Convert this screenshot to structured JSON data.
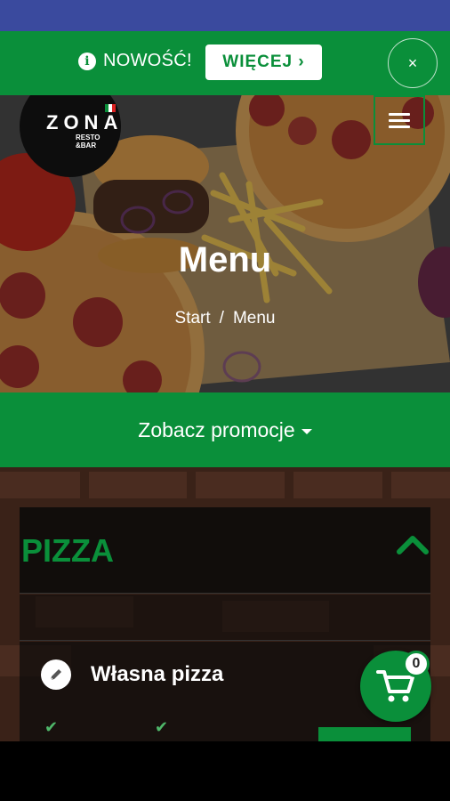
{
  "notice": {
    "text": "NOWOŚĆ!",
    "button_label": "WIĘCEJ ›",
    "close_label": "×"
  },
  "header": {
    "logo_text": "ZONA",
    "logo_sub_line1": "RESTO",
    "logo_sub_line2": "&BAR"
  },
  "hero": {
    "title": "Menu",
    "breadcrumb": {
      "home": "Start",
      "separator": "/",
      "current": "Menu"
    }
  },
  "promotions": {
    "label": "Zobacz promocje"
  },
  "category": {
    "title": "PIZZA"
  },
  "product": {
    "name": "Własna pizza"
  },
  "cart": {
    "count": "0"
  },
  "colors": {
    "brand_green": "#0a8f3a",
    "status_bar": "#3a4a9e"
  },
  "icons": {
    "info": "info-icon",
    "close": "close-icon",
    "menu": "hamburger-icon",
    "collapse": "chevron-up-icon",
    "edit": "pencil-icon",
    "check": "check-icon",
    "cart": "cart-icon"
  }
}
